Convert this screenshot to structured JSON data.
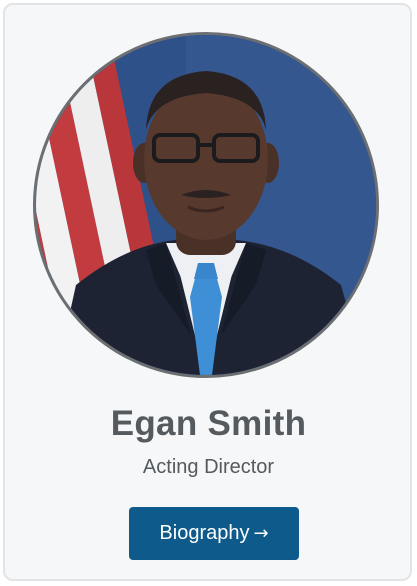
{
  "profile": {
    "name": "Egan Smith",
    "title": "Acting Director"
  },
  "biography_button": {
    "label": "Biography",
    "icon": "arrow-right-icon",
    "arrow_glyph": "→",
    "color": "#0e5a8a"
  },
  "portrait": {
    "alt": "Egan Smith"
  }
}
